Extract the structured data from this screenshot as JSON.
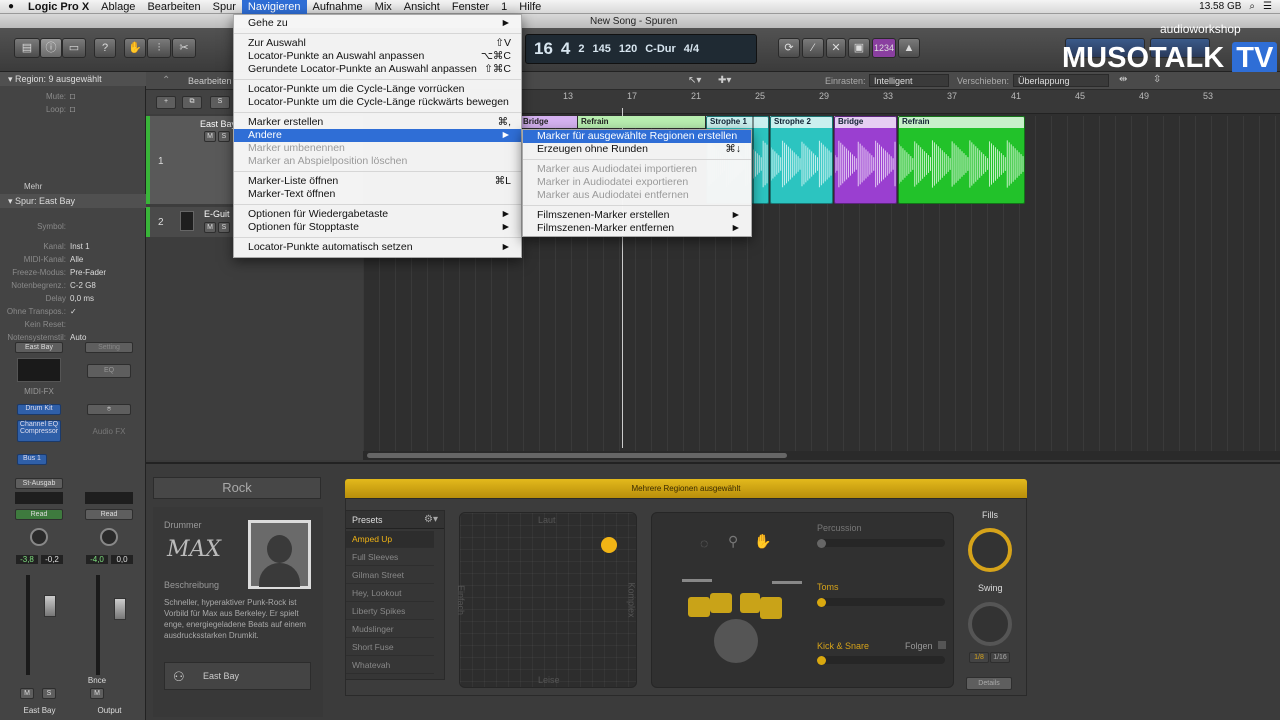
{
  "menubar": {
    "app": "Logic Pro X",
    "items": [
      "Ablage",
      "Bearbeiten",
      "Spur",
      "Navigieren",
      "Aufnahme",
      "Mix",
      "Ansicht",
      "Fenster",
      "1",
      "Hilfe"
    ],
    "active": "Navigieren",
    "storage": "13.58 GB"
  },
  "window": {
    "title": "New Song - Spuren"
  },
  "lcd": {
    "bar": "16",
    "beat": "4",
    "div": "2",
    "tick": "145",
    "tempo": "120",
    "key": "C-Dur",
    "time_sig": "4/4",
    "bar_lbl": "Takt",
    "beat_lbl": "Beat",
    "div_lbl": "Div",
    "tick_lbl": "Tick",
    "tempo_lbl": "Tempo",
    "key_lbl": "Tonart",
    "ts_lbl": "Taktart"
  },
  "watermark": {
    "brand": "MUSOTALK",
    "tv": "TV",
    "site": "audioworkshop"
  },
  "cpu_badge": "1234",
  "arrange": {
    "snap_label": "Einrasten:",
    "snap_value": "Intelligent",
    "drag_label": "Verschieben:",
    "drag_value": "Überlappung",
    "edit_label": "Bearbeiten",
    "ruler": [
      "13",
      "17",
      "21",
      "25",
      "29",
      "33",
      "37",
      "41",
      "45",
      "49",
      "53"
    ]
  },
  "markers": [
    {
      "label": "Bridge",
      "color": "#d6b3f2"
    },
    {
      "label": "Refrain",
      "color": "#b8eeb0"
    },
    {
      "label": "Strophe 1",
      "color": "#b6e6f2"
    },
    {
      "label": "Strophe 2",
      "color": "#b6e6f2"
    },
    {
      "label": "Bridge",
      "color": "#d6b3f2"
    },
    {
      "label": "Refrain",
      "color": "#b8eeb0"
    }
  ],
  "regions": [
    {
      "label": "Strophe 1",
      "color": "#2cc4c0"
    },
    {
      "label": "Strophe 2",
      "color": "#2cc4c0"
    },
    {
      "label": "Bridge",
      "color": "#9a3fd0"
    },
    {
      "label": "Refrain",
      "color": "#22c22a"
    }
  ],
  "tracks": [
    {
      "num": "1",
      "name": "East Bay"
    },
    {
      "num": "2",
      "name": "E-Guit"
    }
  ],
  "inspector": {
    "region": "Region:  9 ausgewählt",
    "mute": "Mute:",
    "loop": "Loop:",
    "more": "Mehr",
    "track": "Spur:  East Bay",
    "rows": [
      {
        "k": "Symbol:",
        "v": ""
      },
      {
        "k": "Kanal:",
        "v": "Inst 1"
      },
      {
        "k": "MIDI-Kanal:",
        "v": "Alle"
      },
      {
        "k": "Freeze-Modus:",
        "v": "Pre-Fader"
      },
      {
        "k": "Notenbegrenz.:",
        "v": "C-2      G8"
      },
      {
        "k": "Delay",
        "v": "0,0 ms"
      },
      {
        "k": "Ohne Transpos.:",
        "v": "✓"
      },
      {
        "k": "Kein Reset:",
        "v": ""
      },
      {
        "k": "Notensystemstil:",
        "v": "Auto"
      }
    ]
  },
  "mixer": {
    "left": {
      "name": "East Bay",
      "midifx": "MIDI-FX",
      "drum": "Drum Kit",
      "eq": "Channel EQ Compressor",
      "bus": "Bus 1",
      "out": "St-Ausgab",
      "read": "Read",
      "vol": "-3,8",
      "pan": "-0,2",
      "m": "M",
      "s": "S",
      "bottom": "East Bay"
    },
    "right": {
      "name": "Setting",
      "eq": "EQ",
      "audiofx": "Audio FX",
      "read": "Read",
      "vol": "-4,0",
      "pan": "0,0",
      "bnce": "Bnce",
      "m": "M",
      "bottom": "Output"
    }
  },
  "drummer": {
    "genre": "Rock",
    "drummer_label": "Drummer",
    "signature": "MAX",
    "desc_label": "Beschreibung",
    "desc": "Schneller, hyperaktiver Punk-Rock ist Vorbild für Max aus Berkeley. Er spielt enge, energiegeladene Beats auf einem ausdrucksstarken Drumkit.",
    "kit_name": "East Bay"
  },
  "region_bar": "Mehrere Regionen ausgewählt",
  "presets": {
    "title": "Presets",
    "items": [
      "Amped Up",
      "Full Sleeves",
      "Gilman Street",
      "Hey, Lookout",
      "Liberty Spikes",
      "Mudslinger",
      "Short Fuse",
      "Whatevah"
    ],
    "selected": "Amped Up"
  },
  "xy": {
    "top": "Laut",
    "bottom": "Leise",
    "left": "Einfach",
    "right": "Komplex"
  },
  "kit": {
    "percussion": "Percussion",
    "toms": "Toms",
    "kick": "Kick & Snare",
    "follow": "Folgen"
  },
  "right_ctrl": {
    "fills": "Fills",
    "swing": "Swing",
    "q1": "1/8",
    "q2": "1/16",
    "details": "Details"
  },
  "menu_nav": [
    {
      "label": "Gehe zu",
      "sc": "►",
      "type": "item"
    },
    {
      "type": "sep"
    },
    {
      "label": "Zur Auswahl",
      "sc": "⇧V",
      "type": "item"
    },
    {
      "label": "Locator-Punkte an Auswahl anpassen",
      "sc": "⌥⌘C",
      "type": "item"
    },
    {
      "label": "Gerundete Locator-Punkte an Auswahl anpassen",
      "sc": "⇧⌘C",
      "type": "item"
    },
    {
      "type": "sep"
    },
    {
      "label": "Locator-Punkte um die Cycle-Länge vorrücken",
      "sc": "",
      "type": "item"
    },
    {
      "label": "Locator-Punkte um die Cycle-Länge rückwärts bewegen",
      "sc": "",
      "type": "item"
    },
    {
      "type": "sep"
    },
    {
      "label": "Marker erstellen",
      "sc": "⌘,",
      "type": "item"
    },
    {
      "label": "Andere",
      "sc": "►",
      "type": "hl"
    },
    {
      "label": "Marker umbenennen",
      "sc": "",
      "type": "dis"
    },
    {
      "label": "Marker an Abspielposition löschen",
      "sc": "",
      "type": "dis"
    },
    {
      "type": "sep"
    },
    {
      "label": "Marker-Liste öffnen",
      "sc": "⌘L",
      "type": "item"
    },
    {
      "label": "Marker-Text öffnen",
      "sc": "",
      "type": "item"
    },
    {
      "type": "sep"
    },
    {
      "label": "Optionen für Wiedergabetaste",
      "sc": "►",
      "type": "item"
    },
    {
      "label": "Optionen für Stopptaste",
      "sc": "►",
      "type": "item"
    },
    {
      "type": "sep"
    },
    {
      "label": "Locator-Punkte automatisch setzen",
      "sc": "►",
      "type": "item"
    }
  ],
  "menu_sub": [
    {
      "label": "Marker für ausgewählte Regionen erstellen",
      "sc": "",
      "type": "hl"
    },
    {
      "label": "Erzeugen ohne Runden",
      "sc": "⌘↓",
      "type": "item"
    },
    {
      "type": "sep"
    },
    {
      "label": "Marker aus Audiodatei importieren",
      "sc": "",
      "type": "dis"
    },
    {
      "label": "Marker in Audiodatei exportieren",
      "sc": "",
      "type": "dis"
    },
    {
      "label": "Marker aus Audiodatei entfernen",
      "sc": "",
      "type": "dis"
    },
    {
      "type": "sep"
    },
    {
      "label": "Filmszenen-Marker erstellen",
      "sc": "►",
      "type": "item"
    },
    {
      "label": "Filmszenen-Marker entfernen",
      "sc": "►",
      "type": "item"
    }
  ]
}
